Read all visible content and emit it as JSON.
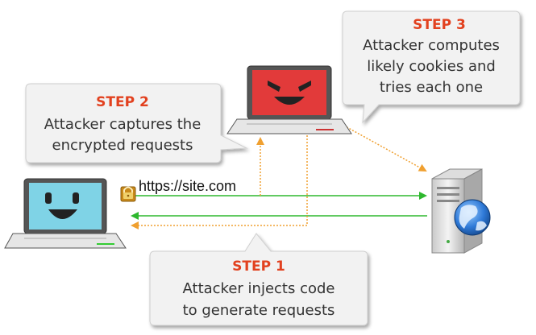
{
  "step1": {
    "title": "STEP 1",
    "lines": [
      "Attacker injects code",
      "to generate requests"
    ]
  },
  "step2": {
    "title": "STEP 2",
    "lines": [
      "Attacker captures the",
      "encrypted requests"
    ]
  },
  "step3": {
    "title": "STEP 3",
    "lines": [
      "Attacker computes",
      "likely cookies and",
      "tries each one"
    ]
  },
  "url": "https://site.com",
  "colors": {
    "accent": "#e2411f",
    "arrow_green": "#2eb82e",
    "arrow_orange": "#f0a030",
    "victim_screen": "#7fd3e6",
    "attacker_screen": "#e23a3a",
    "bubble_fill": "#f2f2f2"
  },
  "icons": {
    "victim": "victim-laptop-icon",
    "attacker": "attacker-laptop-icon",
    "server": "web-server-icon",
    "globe": "globe-icon",
    "lock": "padlock-icon"
  }
}
